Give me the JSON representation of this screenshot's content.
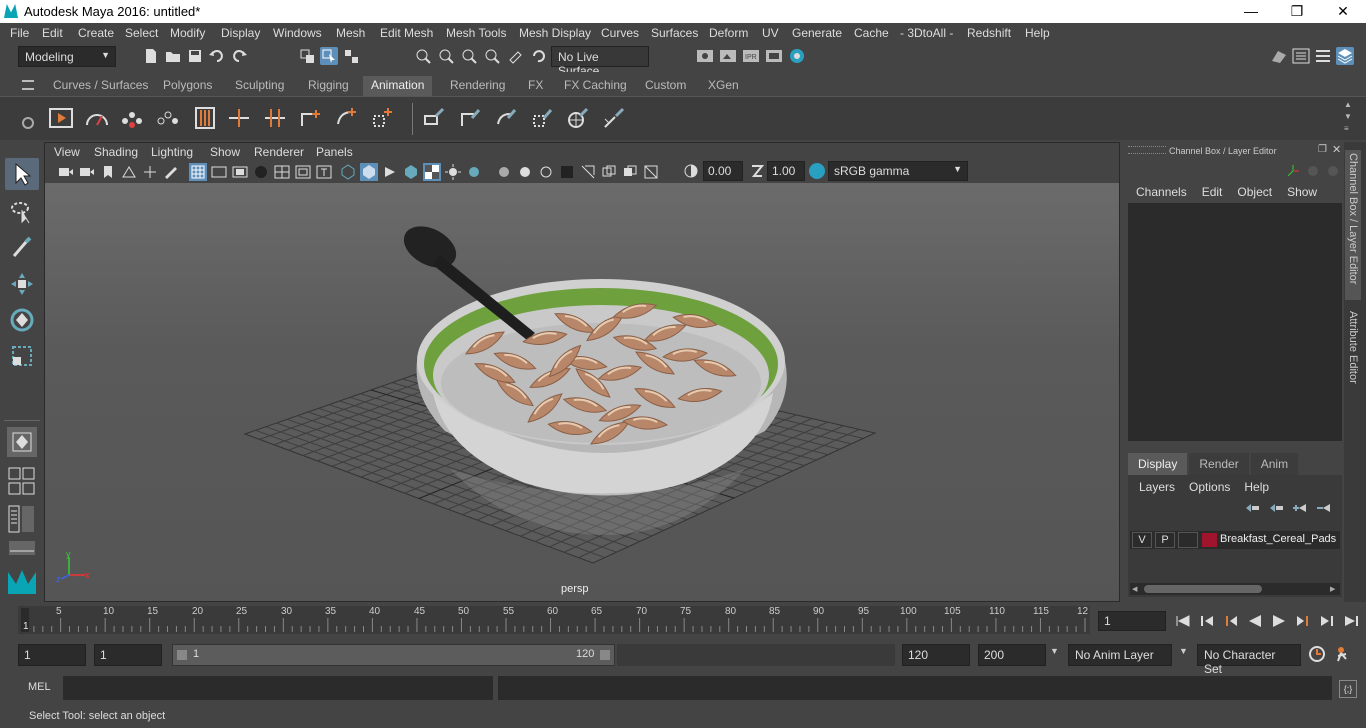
{
  "window": {
    "title": "Autodesk Maya 2016: untitled*",
    "minimize": "—",
    "restore": "❐",
    "close": "✕"
  },
  "menubar": [
    "File",
    "Edit",
    "Create",
    "Select",
    "Modify",
    "Display",
    "Windows",
    "Mesh",
    "Edit Mesh",
    "Mesh Tools",
    "Mesh Display",
    "Curves",
    "Surfaces",
    "Deform",
    "UV",
    "Generate",
    "Cache",
    "- 3DtoAll -",
    "Redshift",
    "Help"
  ],
  "statusline": {
    "mode": "Modeling",
    "live_surface": "No Live Surface"
  },
  "shelf_tabs": [
    "Curves / Surfaces",
    "Polygons",
    "Sculpting",
    "Rigging",
    "Animation",
    "Rendering",
    "FX",
    "FX Caching",
    "Custom",
    "XGen"
  ],
  "shelf_active": "Animation",
  "viewport": {
    "menu": [
      "View",
      "Shading",
      "Lighting",
      "Show",
      "Renderer",
      "Panels"
    ],
    "exposure": "0.00",
    "gamma": "1.00",
    "color_space": "sRGB gamma",
    "camera_label": "persp"
  },
  "channel_box": {
    "title": "Channel Box / Layer Editor",
    "menu": [
      "Channels",
      "Edit",
      "Object",
      "Show"
    ]
  },
  "layer_editor": {
    "tabs": [
      "Display",
      "Render",
      "Anim"
    ],
    "active_tab": "Display",
    "menu": [
      "Layers",
      "Options",
      "Help"
    ],
    "layer": {
      "v": "V",
      "p": "P",
      "name": "Breakfast_Cereal_Pads",
      "color": "#a0142e"
    }
  },
  "side_tabs": [
    "Channel Box / Layer Editor",
    "Attribute Editor"
  ],
  "timeline": {
    "ticks": [
      "5",
      "10",
      "15",
      "20",
      "25",
      "30",
      "35",
      "40",
      "45",
      "50",
      "55",
      "60",
      "65",
      "70",
      "75",
      "80",
      "85",
      "90",
      "95",
      "100",
      "105",
      "110",
      "115",
      "12"
    ],
    "start_marker": "1",
    "current_frame": "1"
  },
  "range": {
    "start": "1",
    "playback_start": "1",
    "slider_start": "1",
    "slider_end": "120",
    "playback_end": "120",
    "end": "200",
    "anim_layer": "No Anim Layer",
    "character_set": "No Character Set"
  },
  "mel": {
    "label": "MEL"
  },
  "help_line": "Select Tool: select an object",
  "colors": {
    "accent": "#5d8fb8",
    "bowl_rim": "#6fa03e",
    "layer": "#a0142e"
  }
}
